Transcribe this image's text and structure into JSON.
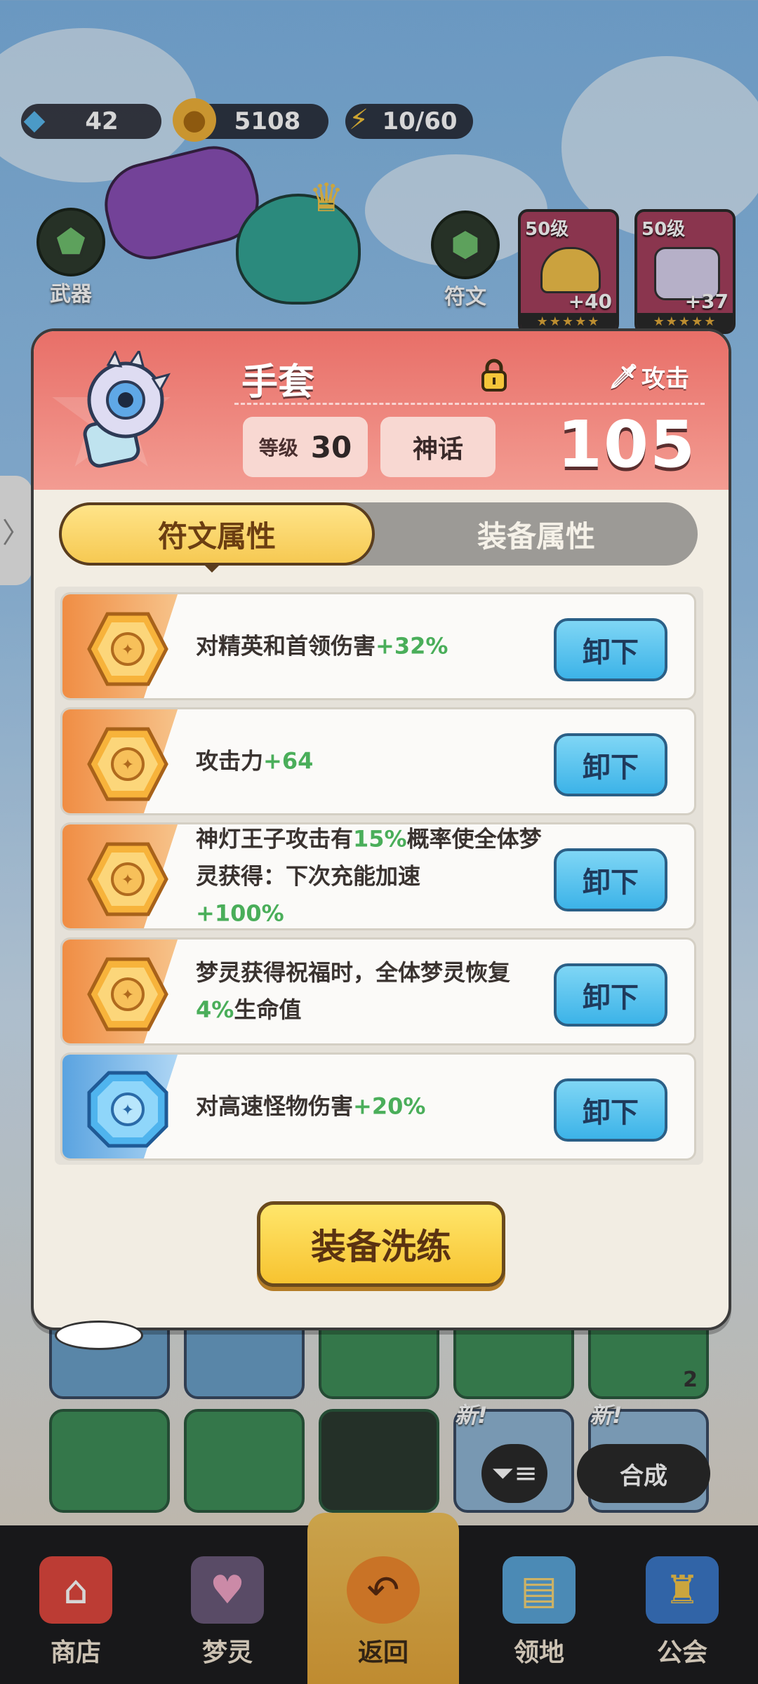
{
  "currency": {
    "gems": "42",
    "gold": "5108",
    "energy": "10/60"
  },
  "side_buttons": {
    "weapon": "武器",
    "rune": "符文"
  },
  "gear_cards": [
    {
      "level": "50级",
      "plus": "+40",
      "stars": "★★★★★"
    },
    {
      "level": "50级",
      "plus": "+37",
      "stars": "★★★★★"
    }
  ],
  "modal": {
    "item_name": "手套",
    "slot_type": "攻击",
    "level_label": "等级",
    "level_value": "30",
    "rarity": "神话",
    "power": "105",
    "tabs": [
      "符文属性",
      "装备属性"
    ],
    "runes": [
      {
        "text": "对精英和首领伤害",
        "bonus": "+32%",
        "gem": "gold",
        "button": "卸下"
      },
      {
        "text": "攻击力",
        "bonus": "+64",
        "gem": "gold",
        "button": "卸下"
      },
      {
        "text_parts": [
          "神灯王子攻击有",
          "15%",
          "概率使全体梦灵获得：下次充能加速",
          "+100%"
        ],
        "gem": "gold",
        "button": "卸下"
      },
      {
        "text_parts": [
          "梦灵获得祝福时，全体梦灵恢复",
          "4%",
          "生命值"
        ],
        "gem": "gold",
        "button": "卸下"
      },
      {
        "text": "对高速怪物伤害",
        "bonus": "+20%",
        "gem": "blue",
        "button": "卸下"
      }
    ],
    "refine_button": "装备洗练"
  },
  "inventory": {
    "new_badge": "新!",
    "count_badge": "2"
  },
  "filter_icon": "filter-icon",
  "synthesize_button": "合成",
  "bottom_nav": [
    {
      "label": "商店",
      "icon": "shop-icon"
    },
    {
      "label": "梦灵",
      "icon": "spirit-icon"
    },
    {
      "label": "返回",
      "icon": "back-icon"
    },
    {
      "label": "领地",
      "icon": "territory-icon"
    },
    {
      "label": "公会",
      "icon": "guild-icon"
    }
  ],
  "colors": {
    "header_red": "#e86f68",
    "tab_gold": "#f6c952",
    "unload_blue": "#3cb3e8",
    "highlight_green": "#4aae5a",
    "refine_yellow": "#f7c330"
  }
}
